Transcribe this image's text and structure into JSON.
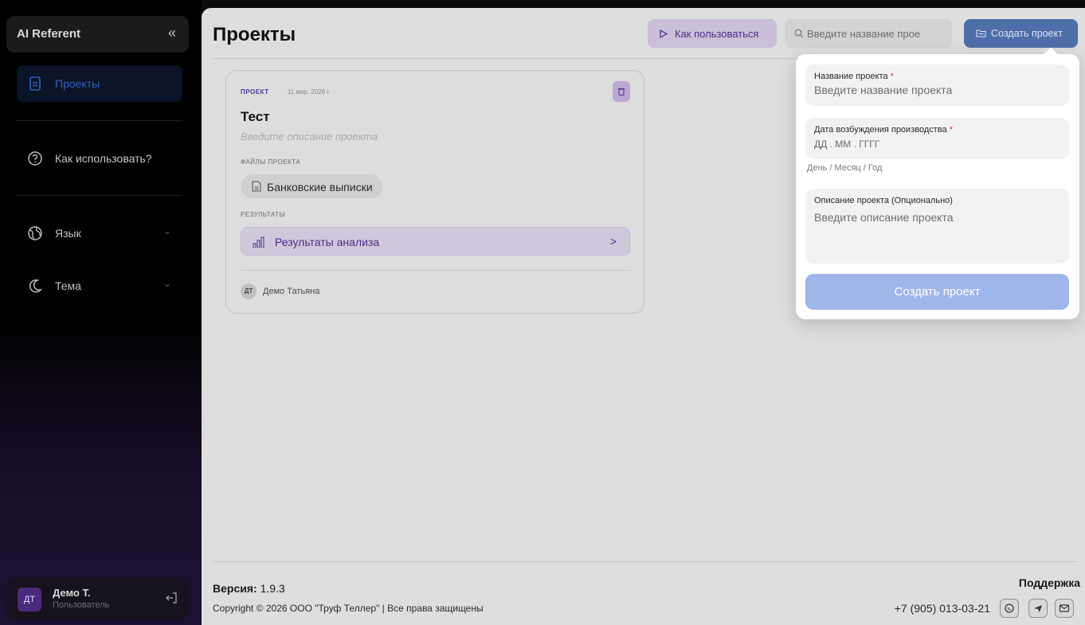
{
  "sidebar": {
    "app_title": "AI Referent",
    "collapse_glyph": "«",
    "items": [
      {
        "label": "Проекты",
        "icon": "document-icon"
      },
      {
        "label": "Как использовать?",
        "icon": "help-circle-icon"
      },
      {
        "label": "Язык",
        "icon": "globe-icon"
      },
      {
        "label": "Тема",
        "icon": "moon-icon"
      }
    ],
    "chevron_glyph": "⌄",
    "user": {
      "initials": "ДТ",
      "name": "Демо Т.",
      "role": "Пользователь"
    }
  },
  "header": {
    "title": "Проекты",
    "how_to_label": "Как пользоваться",
    "search_placeholder": "Введите название прое",
    "create_label": "Создать проект"
  },
  "project_card": {
    "tag": "ПРОЕКТ",
    "date": "· 11 мар. 2026 г.",
    "name": "Тест",
    "description_placeholder": "Введите описание проекта",
    "files_label": "ФАЙЛЫ ПРОЕКТА",
    "file_name": "Банковские выписки",
    "results_label": "РЕЗУЛЬТАТЫ",
    "results_link": "Результаты анализа",
    "results_arrow": ">",
    "owner_initials": "ДТ",
    "owner_name": "Демо Татьяна"
  },
  "footer": {
    "version_label": "Версия:",
    "version": "1.9.3",
    "copyright": "Copyright © 2026 ООО \"Труф Теллер\" | Все права защищены",
    "support_label": "Поддержка",
    "phone": "+7 (905) 013-03-21",
    "socials": [
      "whatsapp-icon",
      "telegram-icon",
      "mail-icon"
    ]
  },
  "create_form": {
    "name_label": "Название проекта",
    "name_placeholder": "Введите название проекта",
    "date_label": "Дата возбуждения производства",
    "date_placeholder": "ДД . ММ . ГГГГ",
    "date_hint": "День / Месяц / Год",
    "desc_label": "Описание проекта (Опционально)",
    "desc_placeholder": "Введите описание проекта",
    "required_mark": "*",
    "submit_label": "Создать проект"
  },
  "colors": {
    "accent_blue": "#4d6fa8",
    "accent_purple": "#4f2c8c",
    "submit_disabled": "#9fb6ea",
    "required": "#e0314b"
  }
}
